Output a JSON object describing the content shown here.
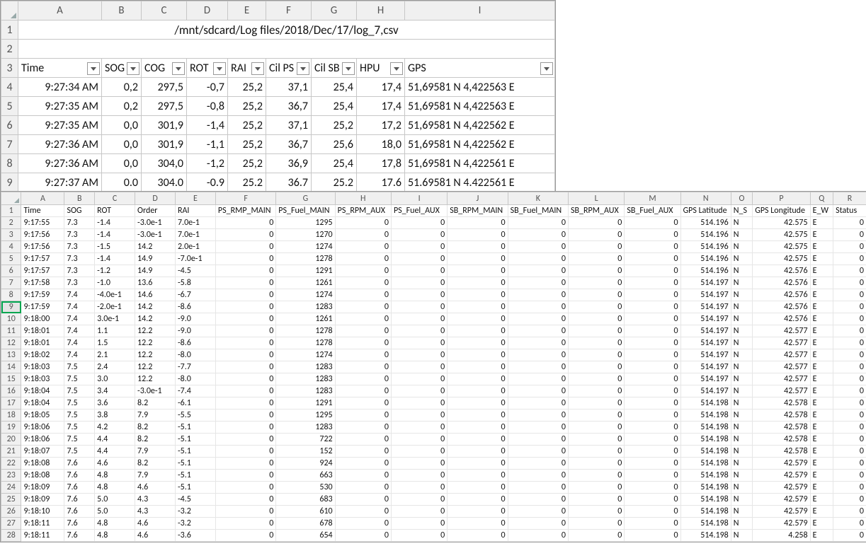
{
  "top": {
    "col_letters": [
      "A",
      "B",
      "C",
      "D",
      "E",
      "F",
      "G",
      "H",
      "I"
    ],
    "title": "/mnt/sdcard/Log files/2018/Dec/17/log_7,csv",
    "filter_headers": [
      "Time",
      "SOG",
      "COG",
      "ROT",
      "RAI",
      "Cil PS",
      "Cil SB",
      "HPU",
      "GPS"
    ],
    "rows": [
      {
        "r": "4",
        "t": "9:27:34 AM",
        "sog": "0,2",
        "cog": "297,5",
        "rot": "-0,7",
        "rai": "25,2",
        "cilps": "37,1",
        "cilsb": "25,4",
        "hpu": "17,4",
        "gps": "51,69581 N 4,422563 E"
      },
      {
        "r": "5",
        "t": "9:27:35 AM",
        "sog": "0,2",
        "cog": "297,5",
        "rot": "-0,8",
        "rai": "25,2",
        "cilps": "36,7",
        "cilsb": "25,4",
        "hpu": "17,4",
        "gps": "51,69581 N 4,422563 E"
      },
      {
        "r": "6",
        "t": "9:27:35 AM",
        "sog": "0,0",
        "cog": "301,9",
        "rot": "-1,4",
        "rai": "25,2",
        "cilps": "37,1",
        "cilsb": "25,2",
        "hpu": "17,2",
        "gps": "51,69581 N 4,422562 E"
      },
      {
        "r": "7",
        "t": "9:27:36 AM",
        "sog": "0,0",
        "cog": "301,9",
        "rot": "-1,1",
        "rai": "25,2",
        "cilps": "36,7",
        "cilsb": "25,6",
        "hpu": "18,0",
        "gps": "51,69581 N 4,422562 E"
      },
      {
        "r": "8",
        "t": "9:27:36 AM",
        "sog": "0,0",
        "cog": "304,0",
        "rot": "-1,2",
        "rai": "25,2",
        "cilps": "36,9",
        "cilsb": "25,4",
        "hpu": "17,8",
        "gps": "51,69581 N 4,422561 E"
      },
      {
        "r": "9",
        "t": "9:27:37 AM",
        "sog": "0.0",
        "cog": "304.0",
        "rot": "-0.9",
        "rai": "25.2",
        "cilps": "36.7",
        "cilsb": "25.2",
        "hpu": "17.6",
        "gps": "51.69581 N 4.422561 E"
      }
    ]
  },
  "bot": {
    "col_letters": [
      "A",
      "B",
      "C",
      "D",
      "E",
      "F",
      "G",
      "H",
      "I",
      "J",
      "K",
      "L",
      "M",
      "N",
      "O",
      "P",
      "Q",
      "R"
    ],
    "headers": [
      "Time",
      "SOG",
      "ROT",
      "Order",
      "RAI",
      "PS_RMP_MAIN",
      "PS_Fuel_MAIN",
      "PS_RPM_AUX",
      "PS_Fuel_AUX",
      "SB_RPM_MAIN",
      "SB_Fuel_MAIN",
      "SB_RPM_AUX",
      "SB_Fuel_AUX",
      "GPS Latitude",
      "N_S",
      "GPS Longitude",
      "E_W",
      "Status"
    ],
    "selected_row": 9,
    "rows": [
      {
        "r": 2,
        "c": [
          "9:17:55",
          "7.3",
          "-1.4",
          "-3.0e-1",
          "7.0e-1",
          "0",
          "1295",
          "0",
          "0",
          "0",
          "0",
          "0",
          "0",
          "514.196",
          "N",
          "42.575",
          "E",
          "0"
        ]
      },
      {
        "r": 3,
        "c": [
          "9:17:56",
          "7.3",
          "-1.4",
          "-3.0e-1",
          "7.0e-1",
          "0",
          "1270",
          "0",
          "0",
          "0",
          "0",
          "0",
          "0",
          "514.196",
          "N",
          "42.575",
          "E",
          "0"
        ]
      },
      {
        "r": 4,
        "c": [
          "9:17:56",
          "7.3",
          "-1.5",
          "14.2",
          "2.0e-1",
          "0",
          "1274",
          "0",
          "0",
          "0",
          "0",
          "0",
          "0",
          "514.196",
          "N",
          "42.575",
          "E",
          "0"
        ]
      },
      {
        "r": 5,
        "c": [
          "9:17:57",
          "7.3",
          "-1.4",
          "14.9",
          "-7.0e-1",
          "0",
          "1278",
          "0",
          "0",
          "0",
          "0",
          "0",
          "0",
          "514.196",
          "N",
          "42.575",
          "E",
          "0"
        ]
      },
      {
        "r": 6,
        "c": [
          "9:17:57",
          "7.3",
          "-1.2",
          "14.9",
          "-4.5",
          "0",
          "1291",
          "0",
          "0",
          "0",
          "0",
          "0",
          "0",
          "514.196",
          "N",
          "42.576",
          "E",
          "0"
        ]
      },
      {
        "r": 7,
        "c": [
          "9:17:58",
          "7.3",
          "-1.0",
          "13.6",
          "-5.8",
          "0",
          "1261",
          "0",
          "0",
          "0",
          "0",
          "0",
          "0",
          "514.197",
          "N",
          "42.576",
          "E",
          "0"
        ]
      },
      {
        "r": 8,
        "c": [
          "9:17:59",
          "7.4",
          "-4.0e-1",
          "14.6",
          "-6.7",
          "0",
          "1274",
          "0",
          "0",
          "0",
          "0",
          "0",
          "0",
          "514.197",
          "N",
          "42.576",
          "E",
          "0"
        ]
      },
      {
        "r": 9,
        "c": [
          "9:17:59",
          "7.4",
          "-2.0e-1",
          "14.2",
          "-8.6",
          "0",
          "1283",
          "0",
          "0",
          "0",
          "0",
          "0",
          "0",
          "514.197",
          "N",
          "42.576",
          "E",
          "0"
        ]
      },
      {
        "r": 10,
        "c": [
          "9:18:00",
          "7.4",
          "3.0e-1",
          "14.2",
          "-9.0",
          "0",
          "1261",
          "0",
          "0",
          "0",
          "0",
          "0",
          "0",
          "514.197",
          "N",
          "42.576",
          "E",
          "0"
        ]
      },
      {
        "r": 11,
        "c": [
          "9:18:01",
          "7.4",
          "1.1",
          "12.2",
          "-9.0",
          "0",
          "1278",
          "0",
          "0",
          "0",
          "0",
          "0",
          "0",
          "514.197",
          "N",
          "42.577",
          "E",
          "0"
        ]
      },
      {
        "r": 12,
        "c": [
          "9:18:01",
          "7.4",
          "1.5",
          "12.2",
          "-8.6",
          "0",
          "1278",
          "0",
          "0",
          "0",
          "0",
          "0",
          "0",
          "514.197",
          "N",
          "42.577",
          "E",
          "0"
        ]
      },
      {
        "r": 13,
        "c": [
          "9:18:02",
          "7.4",
          "2.1",
          "12.2",
          "-8.0",
          "0",
          "1274",
          "0",
          "0",
          "0",
          "0",
          "0",
          "0",
          "514.197",
          "N",
          "42.577",
          "E",
          "0"
        ]
      },
      {
        "r": 14,
        "c": [
          "9:18:03",
          "7.5",
          "2.4",
          "12.2",
          "-7.7",
          "0",
          "1283",
          "0",
          "0",
          "0",
          "0",
          "0",
          "0",
          "514.197",
          "N",
          "42.577",
          "E",
          "0"
        ]
      },
      {
        "r": 15,
        "c": [
          "9:18:03",
          "7.5",
          "3.0",
          "12.2",
          "-8.0",
          "0",
          "1283",
          "0",
          "0",
          "0",
          "0",
          "0",
          "0",
          "514.197",
          "N",
          "42.577",
          "E",
          "0"
        ]
      },
      {
        "r": 16,
        "c": [
          "9:18:04",
          "7.5",
          "3.4",
          "-3.0e-1",
          "-7.4",
          "0",
          "1283",
          "0",
          "0",
          "0",
          "0",
          "0",
          "0",
          "514.197",
          "N",
          "42.577",
          "E",
          "0"
        ]
      },
      {
        "r": 17,
        "c": [
          "9:18:04",
          "7.5",
          "3.6",
          "8.2",
          "-6.1",
          "0",
          "1291",
          "0",
          "0",
          "0",
          "0",
          "0",
          "0",
          "514.198",
          "N",
          "42.578",
          "E",
          "0"
        ]
      },
      {
        "r": 18,
        "c": [
          "9:18:05",
          "7.5",
          "3.8",
          "7.9",
          "-5.5",
          "0",
          "1295",
          "0",
          "0",
          "0",
          "0",
          "0",
          "0",
          "514.198",
          "N",
          "42.578",
          "E",
          "0"
        ]
      },
      {
        "r": 19,
        "c": [
          "9:18:06",
          "7.5",
          "4.2",
          "8.2",
          "-5.1",
          "0",
          "1283",
          "0",
          "0",
          "0",
          "0",
          "0",
          "0",
          "514.198",
          "N",
          "42.578",
          "E",
          "0"
        ]
      },
      {
        "r": 20,
        "c": [
          "9:18:06",
          "7.5",
          "4.4",
          "8.2",
          "-5.1",
          "0",
          "722",
          "0",
          "0",
          "0",
          "0",
          "0",
          "0",
          "514.198",
          "N",
          "42.578",
          "E",
          "0"
        ]
      },
      {
        "r": 21,
        "c": [
          "9:18:07",
          "7.5",
          "4.4",
          "7.9",
          "-5.1",
          "0",
          "152",
          "0",
          "0",
          "0",
          "0",
          "0",
          "0",
          "514.198",
          "N",
          "42.578",
          "E",
          "0"
        ]
      },
      {
        "r": 22,
        "c": [
          "9:18:08",
          "7.6",
          "4.6",
          "8.2",
          "-5.1",
          "0",
          "924",
          "0",
          "0",
          "0",
          "0",
          "0",
          "0",
          "514.198",
          "N",
          "42.579",
          "E",
          "0"
        ]
      },
      {
        "r": 23,
        "c": [
          "9:18:08",
          "7.6",
          "4.8",
          "7.9",
          "-5.1",
          "0",
          "663",
          "0",
          "0",
          "0",
          "0",
          "0",
          "0",
          "514.198",
          "N",
          "42.579",
          "E",
          "0"
        ]
      },
      {
        "r": 24,
        "c": [
          "9:18:09",
          "7.6",
          "4.8",
          "4.6",
          "-5.1",
          "0",
          "530",
          "0",
          "0",
          "0",
          "0",
          "0",
          "0",
          "514.198",
          "N",
          "42.579",
          "E",
          "0"
        ]
      },
      {
        "r": 25,
        "c": [
          "9:18:09",
          "7.6",
          "5.0",
          "4.3",
          "-4.5",
          "0",
          "683",
          "0",
          "0",
          "0",
          "0",
          "0",
          "0",
          "514.198",
          "N",
          "42.579",
          "E",
          "0"
        ]
      },
      {
        "r": 26,
        "c": [
          "9:18:10",
          "7.6",
          "5.0",
          "4.3",
          "-3.2",
          "0",
          "610",
          "0",
          "0",
          "0",
          "0",
          "0",
          "0",
          "514.198",
          "N",
          "42.579",
          "E",
          "0"
        ]
      },
      {
        "r": 27,
        "c": [
          "9:18:11",
          "7.6",
          "4.8",
          "4.6",
          "-3.2",
          "0",
          "678",
          "0",
          "0",
          "0",
          "0",
          "0",
          "0",
          "514.198",
          "N",
          "42.579",
          "E",
          "0"
        ]
      },
      {
        "r": 28,
        "c": [
          "9:18:11",
          "7.6",
          "4.8",
          "4.6",
          "-3.6",
          "0",
          "654",
          "0",
          "0",
          "0",
          "0",
          "0",
          "0",
          "514.198",
          "N",
          "4.258",
          "E",
          "0"
        ]
      }
    ]
  }
}
